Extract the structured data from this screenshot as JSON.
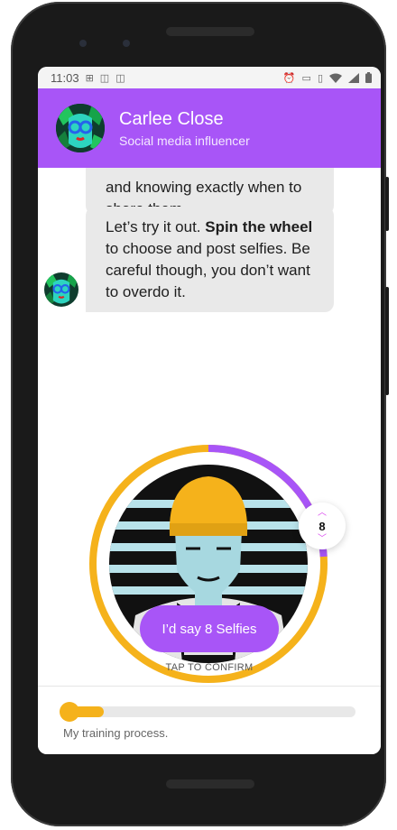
{
  "status_bar": {
    "time": "11:03",
    "left_icons": [
      "sim-icon",
      "data-icon",
      "data-icon"
    ],
    "right_icons": [
      "alarm-icon",
      "cast-icon",
      "vibrate-icon",
      "wifi-icon",
      "signal-icon",
      "battery-icon"
    ]
  },
  "header": {
    "name": "Carlee Close",
    "role": "Social media influencer"
  },
  "chat": {
    "message_1": "and knowing exactly when to share them.",
    "message_2_prefix": "Let’s try it out. ",
    "message_2_bold": "Spin the wheel",
    "message_2_suffix": " to choose and post selfies. Be careful though, you don’t want to overdo it."
  },
  "wheel": {
    "value": "8",
    "fraction": 0.24
  },
  "confirm_button": {
    "label": "I’d say 8 Selfies"
  },
  "tap_label": "TAP TO CONFIRM",
  "training": {
    "label": "My training process.",
    "progress": 0.14
  },
  "colors": {
    "accent": "#a855f7",
    "ring": "#f5b21b",
    "arrow": "#d946ef"
  }
}
